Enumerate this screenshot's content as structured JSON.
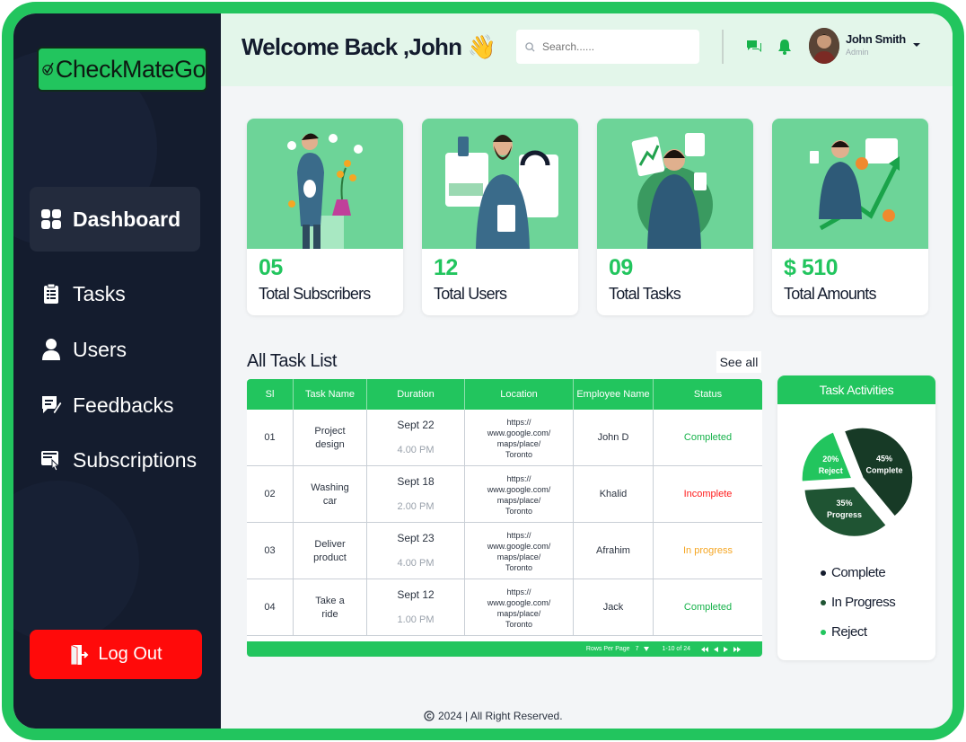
{
  "brand": {
    "name": "CheckMateGo",
    "accent": "#22c55e",
    "sidebar_bg": "#141c2e",
    "danger": "#ff0a0a"
  },
  "sidebar": {
    "items": [
      {
        "label": "Dashboard",
        "icon": "dashboard-icon",
        "active": true
      },
      {
        "label": "Tasks",
        "icon": "clipboard-icon",
        "active": false
      },
      {
        "label": "Users",
        "icon": "user-icon",
        "active": false
      },
      {
        "label": "Feedbacks",
        "icon": "feedback-icon",
        "active": false
      },
      {
        "label": "Subscriptions",
        "icon": "subscription-icon",
        "active": false
      }
    ],
    "logout_label": "Log Out"
  },
  "header": {
    "welcome": "Welcome Back ,John 👋",
    "search_placeholder": "Search......",
    "user_name": "John Smith",
    "user_role": "Admin"
  },
  "stats": [
    {
      "value": "05",
      "label": "Total Subscribers"
    },
    {
      "value": "12",
      "label": "Total Users"
    },
    {
      "value": "09",
      "label": "Total Tasks"
    },
    {
      "value": "$ 510",
      "label": "Total Amounts"
    }
  ],
  "task_list": {
    "title": "All Task List",
    "see_all": "See all",
    "columns": [
      "Sl",
      "Task Name",
      "Duration",
      "Location",
      "Employee Name",
      "Status"
    ],
    "rows": [
      {
        "sl": "01",
        "task": "Project design",
        "date": "Sept 22",
        "time": "4.00 PM",
        "location": "https:// www.google.com/ maps/place/ Toronto",
        "employee": "John D",
        "status": "Completed",
        "status_kind": "completed"
      },
      {
        "sl": "02",
        "task": "Washing car",
        "date": "Sept 18",
        "time": "2.00 PM",
        "location": "https:// www.google.com/ maps/place/ Toronto",
        "employee": "Khalid",
        "status": "Incomplete",
        "status_kind": "incomplete"
      },
      {
        "sl": "03",
        "task": "Deliver product",
        "date": "Sept 23",
        "time": "4.00 PM",
        "location": "https:// www.google.com/ maps/place/ Toronto",
        "employee": "Afrahim",
        "status": "In progress",
        "status_kind": "progress"
      },
      {
        "sl": "04",
        "task": "Take a ride",
        "date": "Sept 12",
        "time": "1.00 PM",
        "location": "https:// www.google.com/ maps/place/ Toronto",
        "employee": "Jack",
        "status": "Completed",
        "status_kind": "completed"
      }
    ],
    "pagination": {
      "rows_per_page_label": "Rows Per Page",
      "rows_per_page": "7",
      "range": "1-10 of 24"
    }
  },
  "activities": {
    "title": "Task Activities",
    "segments": [
      {
        "label": "Complete",
        "percent": 45,
        "color": "#173a26"
      },
      {
        "label": "Progress",
        "percent": 35,
        "color": "#1f5433"
      },
      {
        "label": "Reject",
        "percent": 20,
        "color": "#22c55e"
      }
    ],
    "legend": [
      {
        "label": "Complete",
        "color": "#141c2e"
      },
      {
        "label": "In Progress",
        "color": "#1f5433"
      },
      {
        "label": "Reject",
        "color": "#22c55e"
      }
    ]
  },
  "footer": {
    "text": "2024 | All Right Reserved."
  }
}
